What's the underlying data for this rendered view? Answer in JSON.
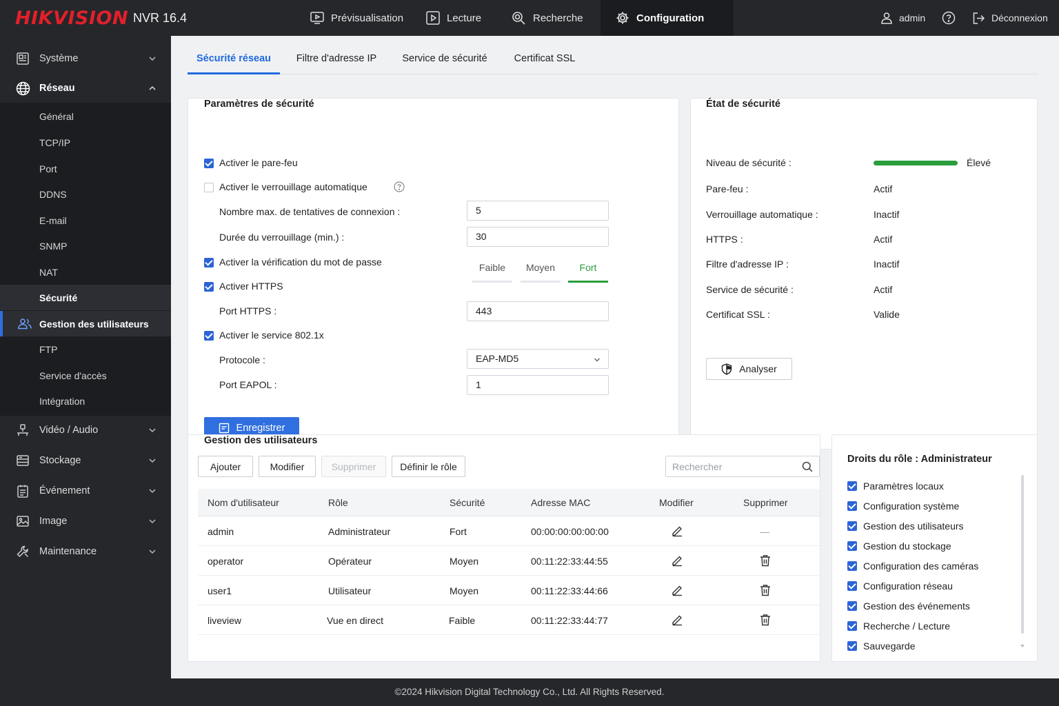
{
  "brand": {
    "logo": "HIKVISION",
    "product": "NVR 16.4",
    "logo_color": "#e1202a",
    "accent": "#2f6fdf"
  },
  "topnav": [
    {
      "label": "Prévisualisation",
      "icon": "monitor-play-icon"
    },
    {
      "label": "Lecture",
      "icon": "play-icon"
    },
    {
      "label": "Recherche",
      "icon": "search-icon"
    },
    {
      "label": "Configuration",
      "icon": "gear-icon",
      "active": true
    }
  ],
  "user": {
    "name": "admin",
    "help_icon": "help-icon",
    "logout": "Déconnexion"
  },
  "sidebar": {
    "groups": {
      "systeme": "Système",
      "reseau": "Réseau",
      "video": "Vidéo / Audio",
      "stockage": "Stockage",
      "evenement": "Événement",
      "image": "Image",
      "maintenance": "Maintenance"
    },
    "reseau_items": [
      "Général",
      "TCP/IP",
      "Port",
      "DDNS",
      "E-mail",
      "SNMP",
      "NAT",
      "Sécurité",
      "Gestion des utilisateurs",
      "FTP",
      "Service d'accès",
      "Intégration"
    ]
  },
  "tabs": [
    "Sécurité réseau",
    "Filtre d'adresse IP",
    "Service de sécurité",
    "Certificat SSL"
  ],
  "security": {
    "title": "Paramètres de sécurité",
    "firewall": {
      "label": "Activer le pare-feu",
      "checked": true
    },
    "autolock": {
      "label": "Activer le verrouillage automatique",
      "checked": false
    },
    "max_attempts": {
      "label": "Nombre max. de tentatives de connexion :",
      "value": "5"
    },
    "lock_duration": {
      "label": "Durée du verrouillage (min.) :",
      "value": "30"
    },
    "password_check": {
      "label": "Activer la vérification du mot de passe",
      "checked": true
    },
    "strength_levels": [
      "Faible",
      "Moyen",
      "Fort"
    ],
    "strength_selected": "Fort",
    "https": {
      "label": "Activer HTTPS",
      "checked": true
    },
    "https_port": {
      "label": "Port HTTPS :",
      "value": "443"
    },
    "dot1x": {
      "label": "Activer le service 802.1x",
      "checked": true
    },
    "protocol": {
      "label": "Protocole :",
      "value": "EAP-MD5"
    },
    "eapol_port": {
      "label": "Port EAPOL :",
      "value": "1"
    },
    "save": "Enregistrer"
  },
  "status": {
    "title": "État de sécurité",
    "level_label": "Niveau de sécurité :",
    "level_value": "Élevé",
    "level_fraction": 1.0,
    "level_color": "#2a9d3c",
    "rows": [
      {
        "label": "Pare-feu :",
        "value": "Actif"
      },
      {
        "label": "Verrouillage automatique :",
        "value": "Inactif"
      },
      {
        "label": "HTTPS :",
        "value": "Actif"
      },
      {
        "label": "Filtre d'adresse IP :",
        "value": "Inactif"
      },
      {
        "label": "Service de sécurité :",
        "value": "Actif"
      },
      {
        "label": "Certificat SSL :",
        "value": "Valide"
      }
    ],
    "analyze": "Analyser"
  },
  "users": {
    "title": "Gestion des utilisateurs",
    "buttons": {
      "add": "Ajouter",
      "edit": "Modifier",
      "delete": "Supprimer",
      "role": "Définir le rôle"
    },
    "search_placeholder": "Rechercher",
    "columns": [
      "Nom d'utilisateur",
      "Rôle",
      "Sécurité",
      "Adresse MAC",
      "Modifier",
      "Supprimer"
    ],
    "rows": [
      {
        "name": "admin",
        "role": "Administrateur",
        "security": "Fort",
        "mac": "00:00:00:00:00:00",
        "delete": "—"
      },
      {
        "name": "operator",
        "role": "Opérateur",
        "security": "Moyen",
        "mac": "00:11:22:33:44:55",
        "delete": "trash-icon"
      },
      {
        "name": "user1",
        "role": "Utilisateur",
        "security": "Moyen",
        "mac": "00:11:22:33:44:66",
        "delete": "trash-icon"
      },
      {
        "name": "liveview",
        "role": "Vue en direct",
        "security": "Faible",
        "mac": "00:11:22:33:44:77",
        "delete": "trash-icon"
      }
    ]
  },
  "rights": {
    "title": "Droits du rôle : Administrateur",
    "items": [
      "Paramètres locaux",
      "Configuration système",
      "Gestion des utilisateurs",
      "Gestion du stockage",
      "Configuration des caméras",
      "Configuration réseau",
      "Gestion des événements",
      "Recherche / Lecture",
      "Sauvegarde"
    ]
  },
  "footer": "©2024 Hikvision Digital Technology Co., Ltd. All Rights Reserved."
}
